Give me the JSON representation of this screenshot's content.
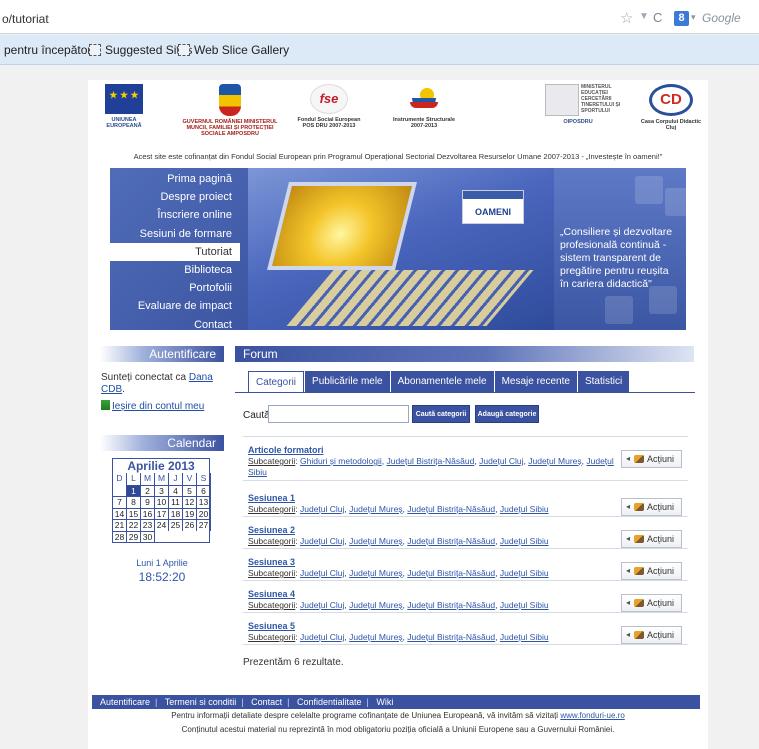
{
  "browser": {
    "url": "o/tutoriat",
    "search_engine": "Google",
    "favorites": [
      "pentru începători",
      "Suggested Sites",
      "Web Slice Gallery"
    ]
  },
  "partners": [
    {
      "name": "UNIUNEA EUROPEANĂ"
    },
    {
      "name": "GUVERNUL ROMÂNIEI MINISTERUL MUNCII, FAMILIEI ȘI PROTECȚIEI SOCIALE AMPOSDRU"
    },
    {
      "name": "Fondul Social European POS DRU 2007-2013"
    },
    {
      "name": "Instrumente Structurale 2007-2013"
    },
    {
      "name": "OIPOSDRU",
      "logo_text": "MINISTERUL EDUCAȚIEI CERCETĂRII TINERETULUI ȘI SPORTULUI"
    },
    {
      "name": "Casa Corpului Didactic Cluj"
    }
  ],
  "cofinance_line": "Acest site este cofinanțat din Fondul Social European prin Programul Operațional Sectorial Dezvoltarea Resurselor Umane 2007-2013 - „Investește în oameni!\"",
  "banner": {
    "menu": [
      "Prima pagină",
      "Despre proiect",
      "Înscriere online",
      "Sesiuni de formare",
      "Tutoriat",
      "Biblioteca",
      "Portofolii",
      "Evaluare de impact",
      "Contact"
    ],
    "active_menu": "Tutoriat",
    "card_text": "OAMENI",
    "slogan": "„Consiliere și dezvoltare profesională continuă - sistem transparent de pregătire pentru reușita în cariera didactică\""
  },
  "sidebar": {
    "auth_title": "Autentificare",
    "connected_prefix": "Sunteți conectat ca",
    "user_name": "Dana CDB",
    "user_suffix": ".",
    "logout": "Ieșire din contul meu",
    "calendar_title": "Calendar",
    "calendar": {
      "month": "Aprilie 2013",
      "day_names": [
        "D",
        "L",
        "M",
        "M",
        "J",
        "V",
        "S"
      ],
      "days": [
        "",
        "1",
        "2",
        "3",
        "4",
        "5",
        "6",
        "7",
        "8",
        "9",
        "10",
        "11",
        "12",
        "13",
        "14",
        "15",
        "16",
        "17",
        "18",
        "19",
        "20",
        "21",
        "22",
        "23",
        "24",
        "25",
        "26",
        "27",
        "28",
        "29",
        "30"
      ],
      "today": "1",
      "date_label": "Luni 1 Aprilie",
      "time": "18:52:20"
    }
  },
  "forum": {
    "title": "Forum",
    "tabs": [
      "Categorii",
      "Publicările mele",
      "Abonamentele mele",
      "Mesaje recente",
      "Statistici"
    ],
    "active_tab": "Categorii",
    "search_label": "Caută",
    "search_value": "",
    "search_button": "Caută categorii",
    "add_button": "Adaugă categorie",
    "subcat_label": "Subcategorii",
    "action_label": "Acțiuni",
    "categories": [
      {
        "name": "Articole formatori",
        "subs": [
          "Ghiduri și metodologii",
          "Județul Bistrița-Năsăud",
          "Județul Cluj",
          "Județul Mureș",
          "Județul Sibiu"
        ]
      },
      {
        "name": "Sesiunea 1",
        "subs": [
          "Județul Cluj",
          "Județul Mureș",
          "Județul Bistrița-Năsăud",
          "Județul Sibiu"
        ]
      },
      {
        "name": "Sesiunea 2",
        "subs": [
          "Județul Cluj",
          "Județul Mureș",
          "Județul Bistrița-Năsăud",
          "Județul Sibiu"
        ]
      },
      {
        "name": "Sesiunea 3",
        "subs": [
          "Județul Cluj",
          "Județul Mureș",
          "Județul Bistrița-Năsăud",
          "Județul Sibiu"
        ]
      },
      {
        "name": "Sesiunea 4",
        "subs": [
          "Județul Cluj",
          "Județul Mureș",
          "Județul Bistrița-Năsăud",
          "Județul Sibiu"
        ]
      },
      {
        "name": "Sesiunea 5",
        "subs": [
          "Județul Cluj",
          "Județul Mureș",
          "Județul Bistrița-Năsăud",
          "Județul Sibiu"
        ]
      }
    ],
    "results": "Prezentăm 6 rezultate."
  },
  "footer": {
    "links": [
      "Autentificare",
      "Termeni si conditii",
      "Contact",
      "Confidentialitate",
      "Wiki"
    ],
    "info_text": "Pentru informații detaliate despre celelalte programe cofinanțate de Uniunea Europeană, vă invităm să vizitați",
    "info_link": "www.fonduri-ue.ro",
    "disclaimer": "Conținutul acestui material nu reprezintă în mod obligatoriu poziția oficială a Uniunii Europene sau a Guvernului României."
  }
}
